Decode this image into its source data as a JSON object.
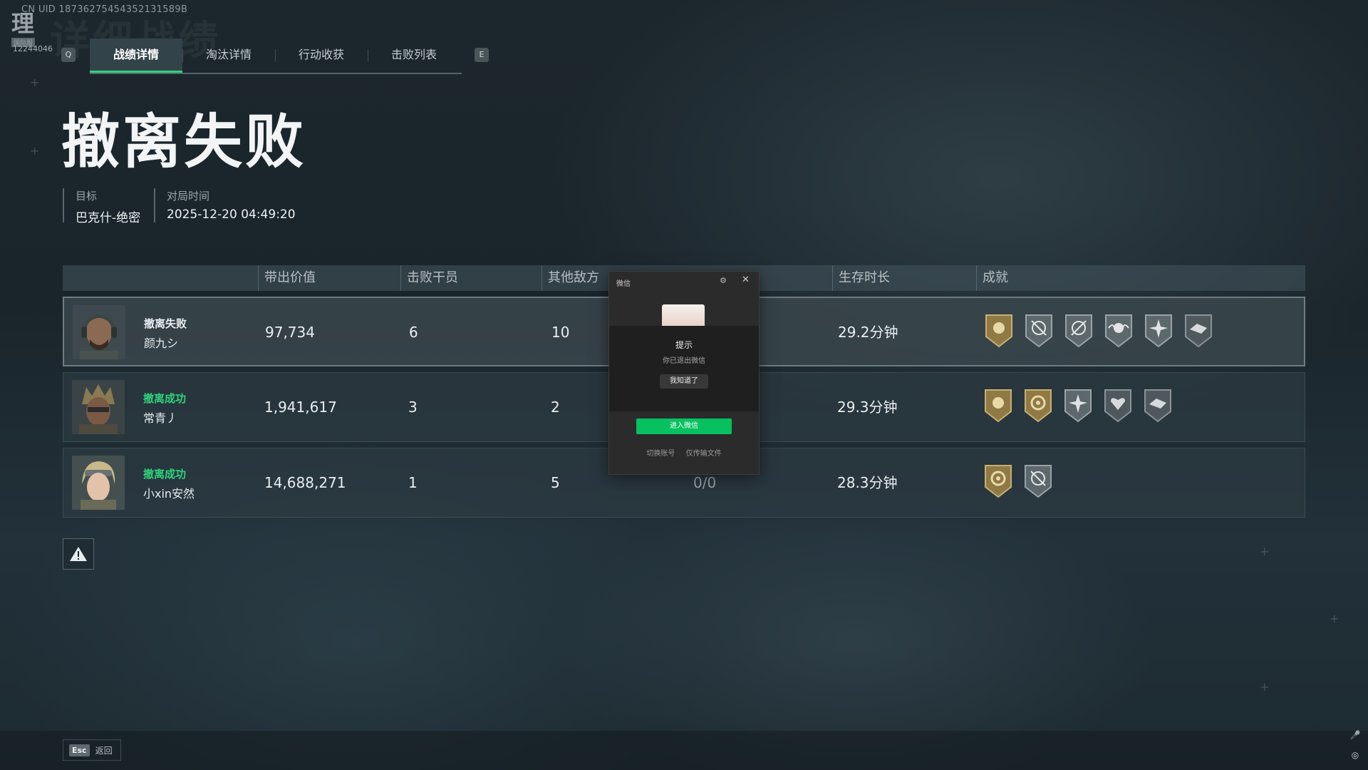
{
  "header": {
    "uid": "CN UID 18736275454352131589B",
    "logo_glyph": "理",
    "logo_sub": "国际服",
    "logo_number": "12244046",
    "background_title": "详细战绩"
  },
  "tabs": {
    "left_key": "Q",
    "right_key": "E",
    "items": [
      {
        "label": "战绩详情",
        "active": true
      },
      {
        "label": "淘汰详情",
        "active": false
      },
      {
        "label": "行动收获",
        "active": false
      },
      {
        "label": "击败列表",
        "active": false
      }
    ]
  },
  "result_title": "撤离失败",
  "meta": {
    "target_label": "目标",
    "target_value": "巴克什-绝密",
    "time_label": "对局时间",
    "time_value": "2025-12-20 04:49:20"
  },
  "table": {
    "headers": [
      "带出价值",
      "击败干员",
      "其他敌方",
      "生存时长",
      "成就"
    ],
    "rows": [
      {
        "status": "撤离失败",
        "status_color": "#e9eef0",
        "name": "颜九シ",
        "value": "97,734",
        "kills": "6",
        "others": "10",
        "mid": "",
        "time": "29.2分钟"
      },
      {
        "status": "撤离成功",
        "status_color": "#2fd37b",
        "name": "常青丿",
        "value": "1,941,617",
        "kills": "3",
        "others": "2",
        "mid": "",
        "time": "29.3分钟"
      },
      {
        "status": "撤离成功",
        "status_color": "#2fd37b",
        "name": "小xin安然",
        "value": "14,688,271",
        "kills": "1",
        "others": "5",
        "mid": "0/0",
        "time": "28.3分钟"
      }
    ]
  },
  "dialog": {
    "title": "微信",
    "prompt": "提示",
    "message": "你已退出微信",
    "ok_label": "我知道了",
    "enter_label": "进入微信",
    "link_switch": "切换账号",
    "link_transfer": "仅传输文件"
  },
  "footer": {
    "esc_key": "Esc",
    "esc_label": "返回"
  },
  "colors": {
    "accent_green": "#2fd37b",
    "wechat_green": "#07c160"
  }
}
